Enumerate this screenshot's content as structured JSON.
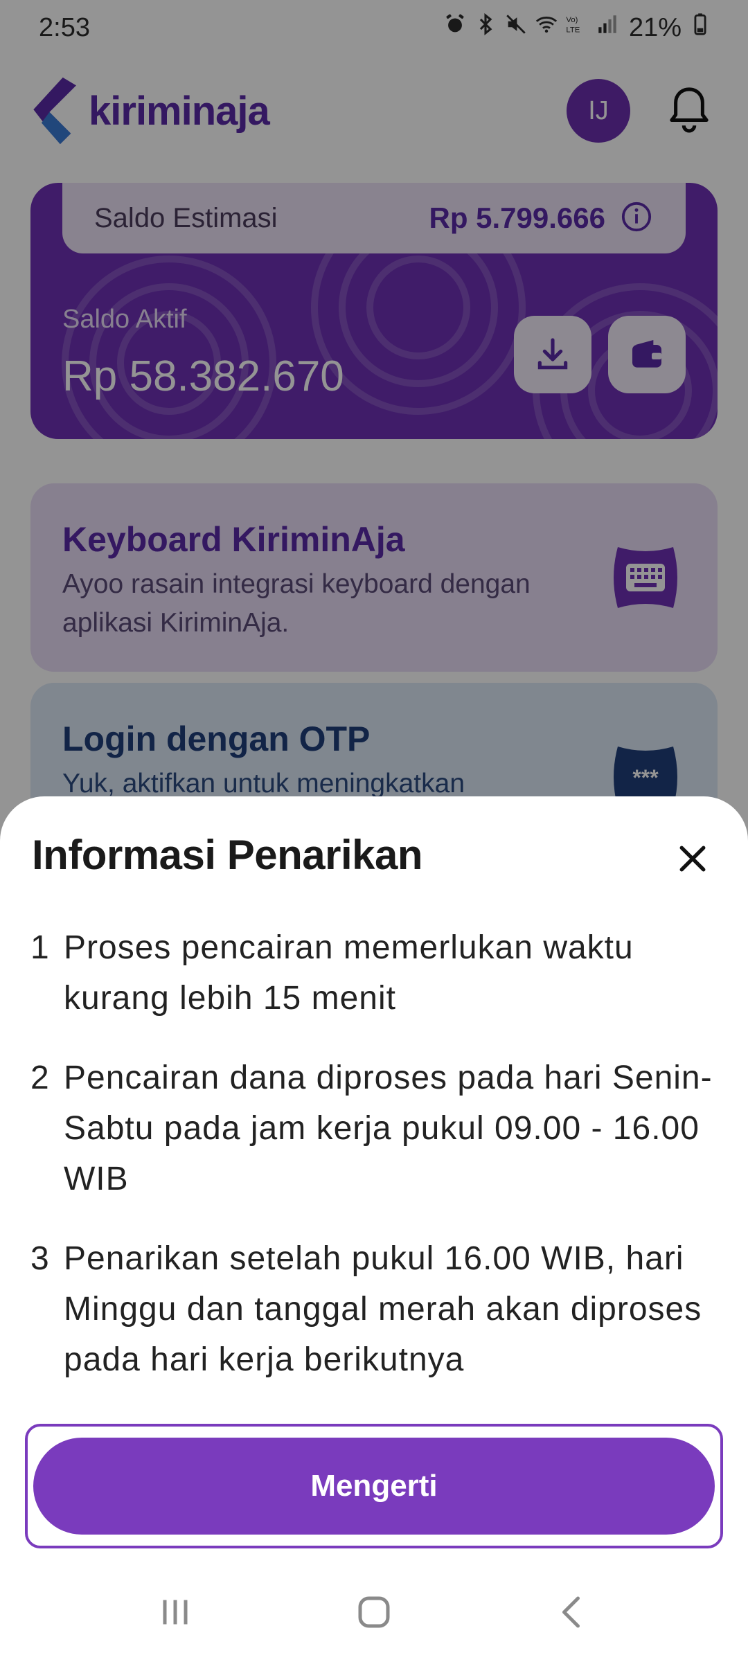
{
  "status_bar": {
    "time": "2:53",
    "battery": "21%",
    "icons": [
      "alarm-icon",
      "bluetooth-icon",
      "mute-icon",
      "wifi-icon",
      "volte-icon",
      "signal-icon",
      "battery-icon"
    ]
  },
  "header": {
    "logo_text": "kiriminaja",
    "avatar_initials": "IJ",
    "notification_icon": "bell-icon"
  },
  "balance": {
    "estimasi_label": "Saldo Estimasi",
    "estimasi_value": "Rp 5.799.666",
    "aktif_label": "Saldo Aktif",
    "aktif_value": "Rp 58.382.670",
    "actions": [
      "download-icon",
      "wallet-icon"
    ]
  },
  "promos": [
    {
      "title": "Keyboard KiriminAja",
      "desc": "Ayoo rasain integrasi keyboard dengan aplikasi KiriminAja.",
      "icon": "keyboard-icon"
    },
    {
      "title": "Login dengan OTP",
      "desc": "Yuk, aktifkan untuk meningkatkan",
      "icon": "otp-password-icon"
    }
  ],
  "sheet": {
    "title": "Informasi Penarikan",
    "items": [
      {
        "num": "1",
        "text": "Proses pencairan memerlukan waktu kurang lebih 15 menit"
      },
      {
        "num": "2",
        "text": "Pencairan dana diproses pada hari Senin-Sabtu pada jam kerja pukul 09.00 - 16.00 WIB"
      },
      {
        "num": "3",
        "text": "Penarikan setelah pukul 16.00 WIB, hari Minggu dan tanggal merah akan diproses pada hari kerja berikutnya"
      }
    ],
    "button_label": "Mengerti"
  },
  "colors": {
    "brand_purple": "#7a3bbd",
    "card_purple": "#6e31b6",
    "scrim": "rgba(0,0,0,0.42)"
  }
}
